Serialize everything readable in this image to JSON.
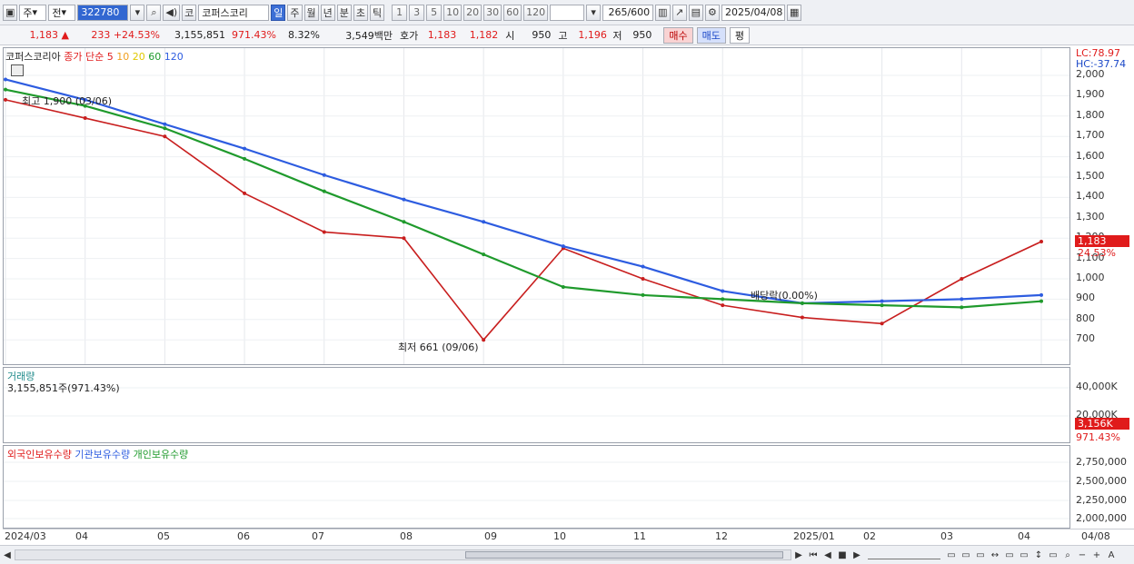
{
  "toolbar": {
    "first_dropdown": "주",
    "second_dropdown": "전",
    "code": "322780",
    "stock_button": "코",
    "stock_name": "코퍼스코리",
    "periods": [
      "일",
      "주",
      "월",
      "년",
      "분",
      "초",
      "틱"
    ],
    "active_period": "일",
    "intervals": [
      "1",
      "3",
      "5",
      "10",
      "20",
      "30",
      "60",
      "120"
    ],
    "count": "265",
    "count_total": "/600",
    "date": "2025/04/08"
  },
  "quote": {
    "price": "1,183",
    "change": "233",
    "change_pct": "+24.53%",
    "volume": "3,155,851",
    "volume_ratio": "971.43%",
    "turnover": "8.32%",
    "amount": "3,549백만",
    "bid_label": "호가",
    "ask": "1,183",
    "bid": "1,182",
    "open_label": "시",
    "open": "950",
    "high_label": "고",
    "high": "1,196",
    "low_label": "저",
    "low": "950",
    "buy_label": "매수",
    "sell_label": "매도",
    "avg_label": "평"
  },
  "price_pane": {
    "legend_name": "코퍼스코리아",
    "legend_ma_prefix": "종가 단순",
    "ma_labels": [
      "5",
      "10",
      "20",
      "60",
      "120"
    ],
    "ma_colors": [
      "#e01b1b",
      "#f08a1c",
      "#f2e200",
      "#1f9a2c",
      "#2d5ce0"
    ],
    "high_annotation": "최고 1,900 (03/06)",
    "low_annotation": "최저 661 (09/06)",
    "event_annotation": "배당락(0.00%)",
    "lc_label": "LC:78.97",
    "hc_label": "HC:-37.74",
    "y_ticks": [
      "2,000",
      "1,900",
      "1,800",
      "1,700",
      "1,600",
      "1,500",
      "1,400",
      "1,300",
      "1,200",
      "1,100",
      "1,000",
      "900",
      "800",
      "700"
    ],
    "price_tag": "1,183",
    "change_tag": "24.53%"
  },
  "volume_pane": {
    "title": "거래량",
    "value": "3,155,851주(971.43%)",
    "y_ticks": [
      "40,000K",
      "20,000K"
    ],
    "tag": "3,156K",
    "tag2": "971.43%"
  },
  "holdings_pane": {
    "legend": [
      "외국인보유수량",
      "기관보유수량",
      "개인보유수량"
    ],
    "legend_colors": [
      "#e01b1b",
      "#2d5ce0",
      "#1f9a2c"
    ],
    "y_ticks": [
      "2,750,000",
      "2,500,000",
      "2,250,000",
      "2,000,000"
    ]
  },
  "x_axis": [
    "2024/03",
    "04",
    "05",
    "06",
    "07",
    "08",
    "09",
    "10",
    "11",
    "12",
    "2025/01",
    "02",
    "03",
    "04",
    "04/08"
  ],
  "chart_data": {
    "type": "line",
    "title": "",
    "x": [
      "2024/03",
      "04",
      "05",
      "06",
      "07",
      "08",
      "09",
      "10",
      "11",
      "12",
      "2025/01",
      "02",
      "03",
      "04/08"
    ],
    "ylim": [
      650,
      2000
    ],
    "series": [
      {
        "name": "코퍼스코리아",
        "values": [
          1880,
          1790,
          1700,
          1420,
          1230,
          1200,
          700,
          1150,
          1000,
          870,
          810,
          780,
          1000,
          1183
        ]
      },
      {
        "name": "120",
        "values": [
          1980,
          1880,
          1760,
          1640,
          1510,
          1390,
          1280,
          1160,
          1060,
          940,
          880,
          890,
          900,
          920
        ]
      },
      {
        "name": "60",
        "values": [
          1930,
          1850,
          1740,
          1590,
          1430,
          1280,
          1120,
          960,
          920,
          900,
          880,
          870,
          860,
          890
        ]
      }
    ]
  }
}
